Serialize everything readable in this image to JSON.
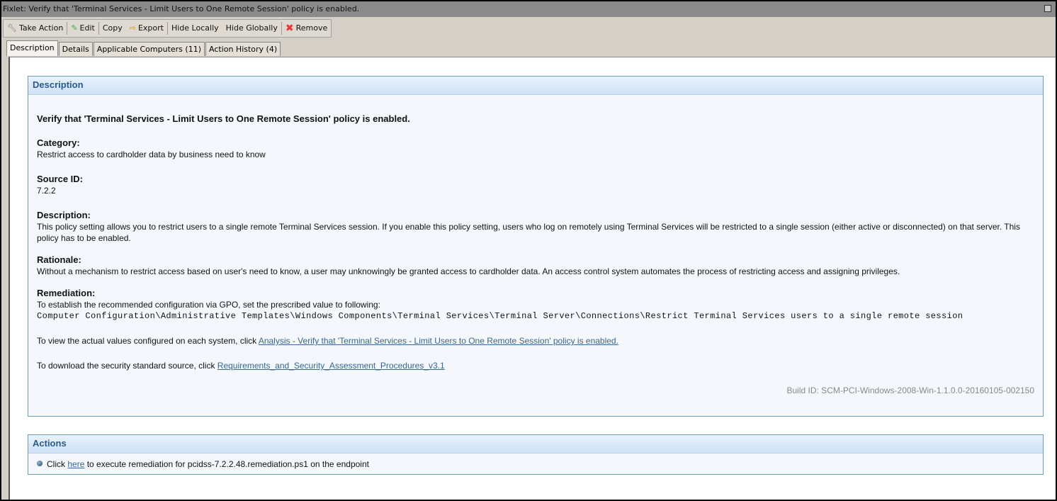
{
  "window": {
    "title": "Fixlet: Verify that 'Terminal Services - Limit Users to One Remote Session' policy is enabled."
  },
  "toolbar": {
    "take_action": "Take Action",
    "edit": "Edit",
    "copy": "Copy",
    "export": "Export",
    "hide_locally": "Hide Locally",
    "hide_globally": "Hide Globally",
    "remove": "Remove"
  },
  "tabs": [
    "Description",
    "Details",
    "Applicable Computers (11)",
    "Action History (4)"
  ],
  "description": {
    "header": "Description",
    "title": "Verify that 'Terminal Services - Limit Users to One Remote Session' policy is enabled.",
    "category_label": "Category:",
    "category": "Restrict access to cardholder data by business need to know",
    "source_label": "Source ID:",
    "source": "7.2.2",
    "desc_label": "Description:",
    "desc": "This policy setting allows you to restrict users to a single remote Terminal Services session. If you enable this policy setting, users who log on remotely using Terminal Services will be restricted to a single session (either active or disconnected) on that server. This policy has to be enabled.",
    "rationale_label": "Rationale:",
    "rationale": "Without a mechanism to restrict access based on user's need to know, a user may unknowingly be granted access to cardholder data. An access control system automates the process of restricting access and assigning privileges.",
    "remediation_label": "Remediation:",
    "remediation": "To establish the recommended configuration via GPO, set the prescribed value to following:",
    "path": "Computer Configuration\\Administrative Templates\\Windows Components\\Terminal Services\\Terminal Server\\Connections\\Restrict Terminal Services users to a single remote session",
    "view_text": "To view the actual values configured on each system, click ",
    "view_link": "Analysis - Verify that 'Terminal Services - Limit Users to One Remote Session' policy is enabled.",
    "download_text": "To download the security standard source, click ",
    "download_link": "Requirements_and_Security_Assessment_Procedures_v3.1",
    "build": "Build ID: SCM-PCI-Windows-2008-Win-1.1.0.0-20160105-002150"
  },
  "actions": {
    "header": "Actions",
    "pre": "Click ",
    "link": "here",
    "post": " to execute remediation for pcidss-7.2.2.48.remediation.ps1 on the endpoint"
  }
}
